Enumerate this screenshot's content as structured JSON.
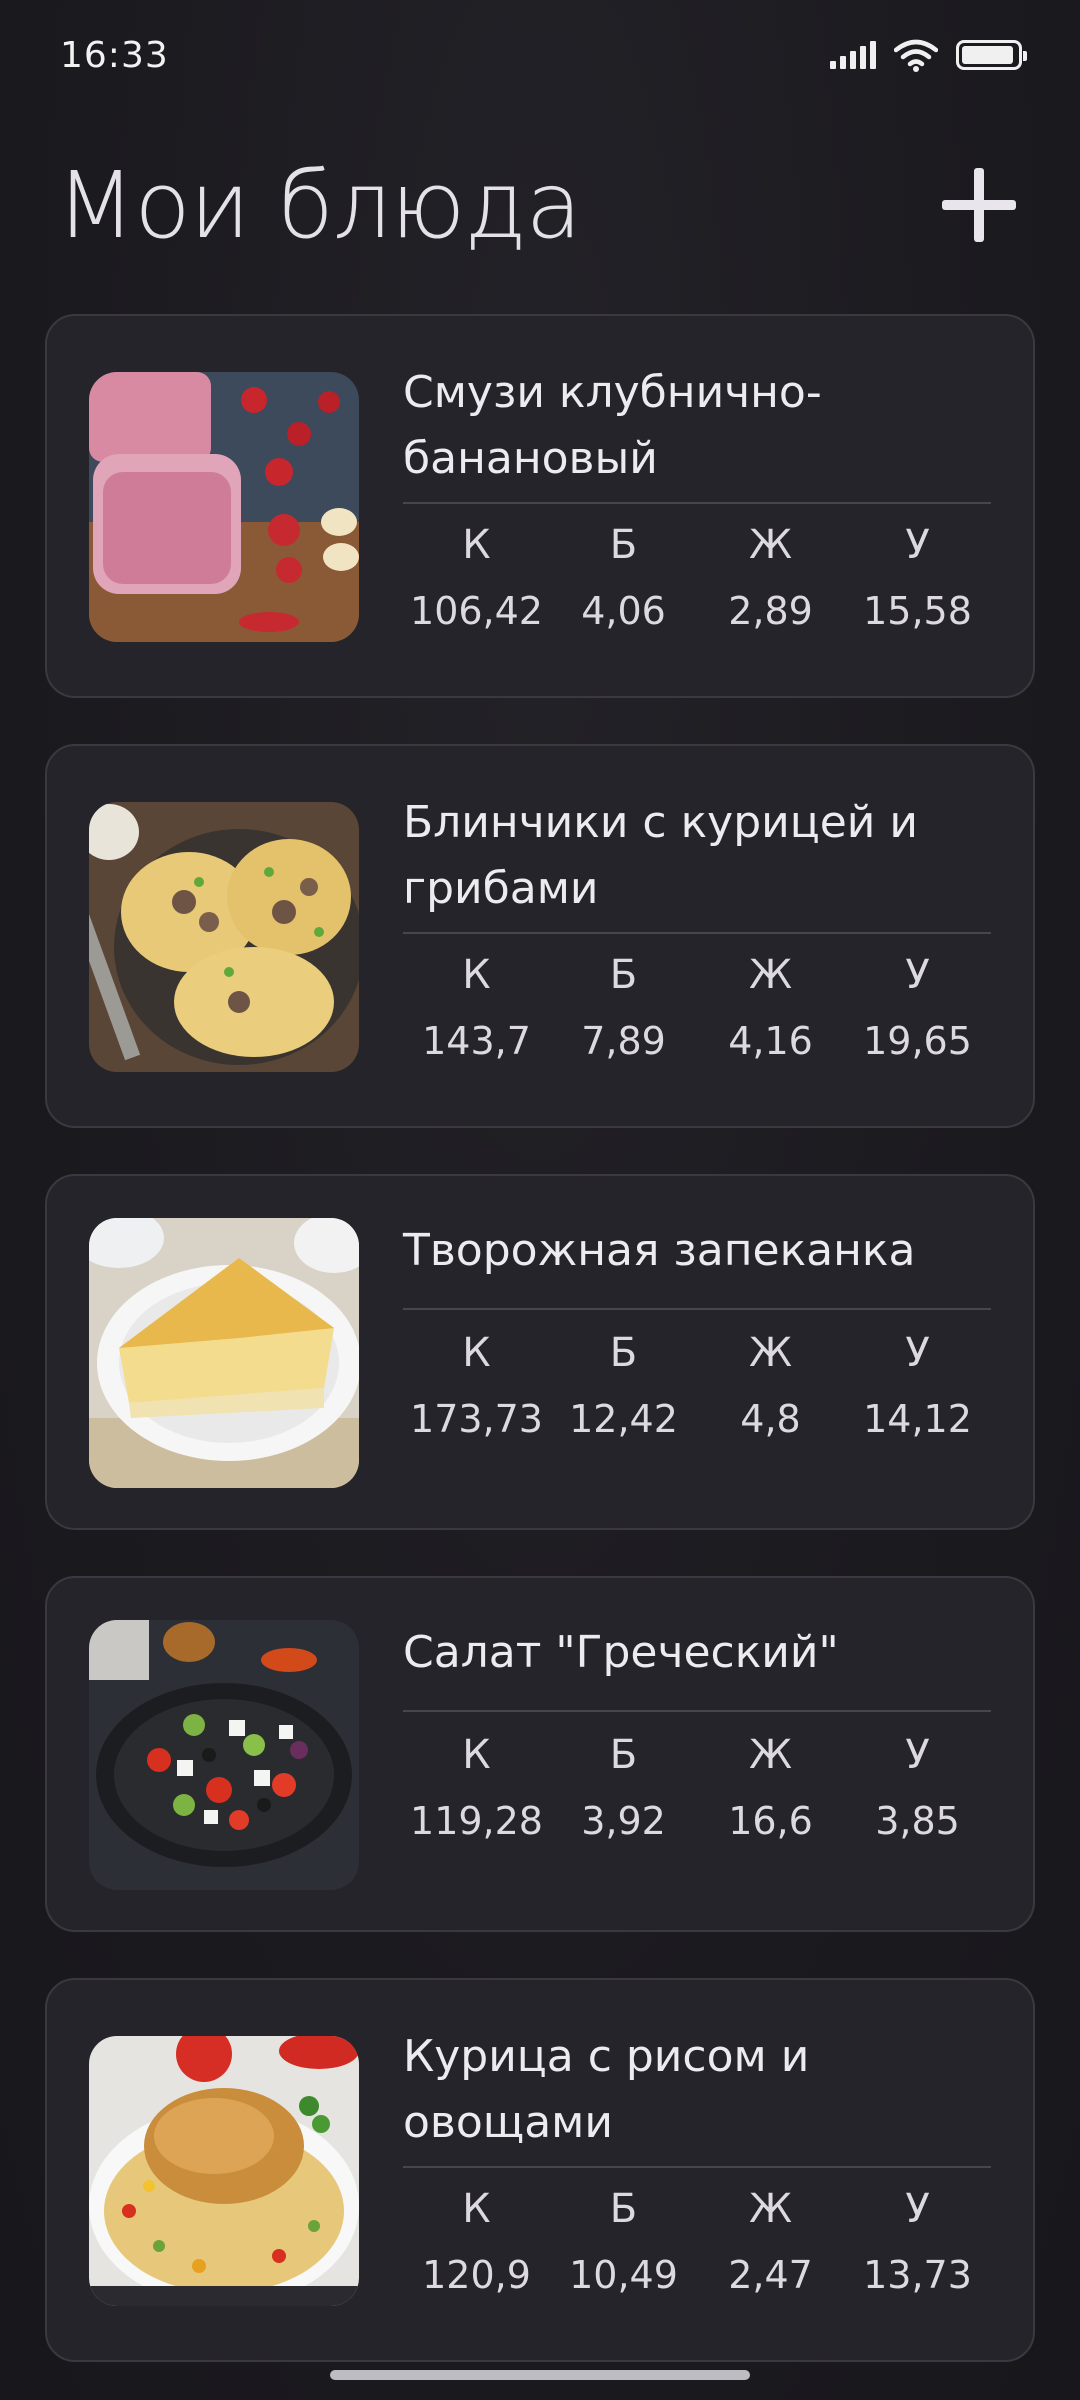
{
  "status_bar": {
    "time": "16:33",
    "battery_level": 0.95
  },
  "header": {
    "title": "Мои блюда"
  },
  "macro_labels": {
    "k": "К",
    "b": "Б",
    "zh": "Ж",
    "u": "У"
  },
  "dishes": [
    {
      "name": "Смузи клубнично-банановый",
      "k": "106,42",
      "b": "4,06",
      "zh": "2,89",
      "u": "15,58",
      "image_icon": "smoothie-photo"
    },
    {
      "name": "Блинчики с курицей и грибами",
      "k": "143,7",
      "b": "7,89",
      "zh": "4,16",
      "u": "19,65",
      "image_icon": "pancakes-photo"
    },
    {
      "name": "Творожная запеканка",
      "k": "173,73",
      "b": "12,42",
      "zh": "4,8",
      "u": "14,12",
      "image_icon": "casserole-photo"
    },
    {
      "name": "Салат \"Греческий\"",
      "k": "119,28",
      "b": "3,92",
      "zh": "16,6",
      "u": "3,85",
      "image_icon": "greek-salad-photo"
    },
    {
      "name": "Курица с рисом и овощами",
      "k": "120,9",
      "b": "10,49",
      "zh": "2,47",
      "u": "13,73",
      "image_icon": "chicken-rice-photo"
    }
  ]
}
